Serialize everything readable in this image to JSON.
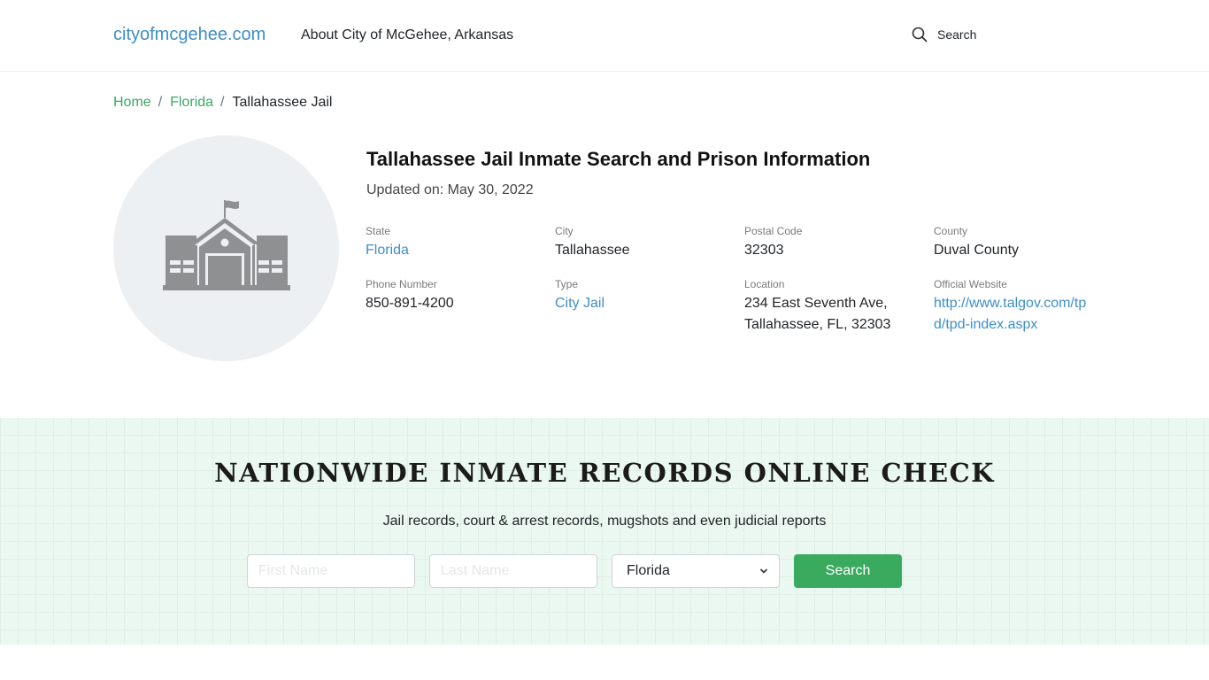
{
  "header": {
    "logo": "cityofmcgehee.com",
    "nav_about": "About City of McGehee, Arkansas",
    "search_label": "Search",
    "search_icon": "search-icon"
  },
  "breadcrumb": {
    "items": [
      {
        "label": "Home"
      },
      {
        "label": "Florida"
      },
      {
        "label": "Tallahassee Jail"
      }
    ],
    "separator": "/"
  },
  "facility": {
    "image_icon": "school-building-icon",
    "title": "Tallahassee Jail Inmate Search and Prison Information",
    "updated_prefix": "Updated on:",
    "updated_date": "May 30, 2022",
    "fields": {
      "state": {
        "label": "State",
        "value": "Florida"
      },
      "city": {
        "label": "City",
        "value": "Tallahassee"
      },
      "postal_code": {
        "label": "Postal Code",
        "value": "32303"
      },
      "county": {
        "label": "County",
        "value": "Duval County"
      },
      "phone": {
        "label": "Phone Number",
        "value": "850-891-4200"
      },
      "type": {
        "label": "Type",
        "value": "City Jail"
      },
      "location": {
        "label": "Location",
        "value": "234 East Seventh Ave, Tallahassee, FL, 32303"
      },
      "website": {
        "label": "Official Website",
        "value": "http://www.talgov.com/tpd/tpd-index.aspx"
      }
    }
  },
  "promo": {
    "title": "NATIONWIDE INMATE RECORDS ONLINE CHECK",
    "subtitle": "Jail records, court & arrest records, mugshots and even judicial reports",
    "first_name": {
      "value": "",
      "placeholder": "First Name"
    },
    "last_name": {
      "value": "",
      "placeholder": "Last Name"
    },
    "state_select": {
      "selected": "Florida"
    },
    "search_button": "Search",
    "colors": {
      "background": "#eaf8f1",
      "button": "#3aaa5e"
    }
  },
  "colors": {
    "link_blue": "#3d8fc6",
    "breadcrumb_green": "#3aa864"
  }
}
